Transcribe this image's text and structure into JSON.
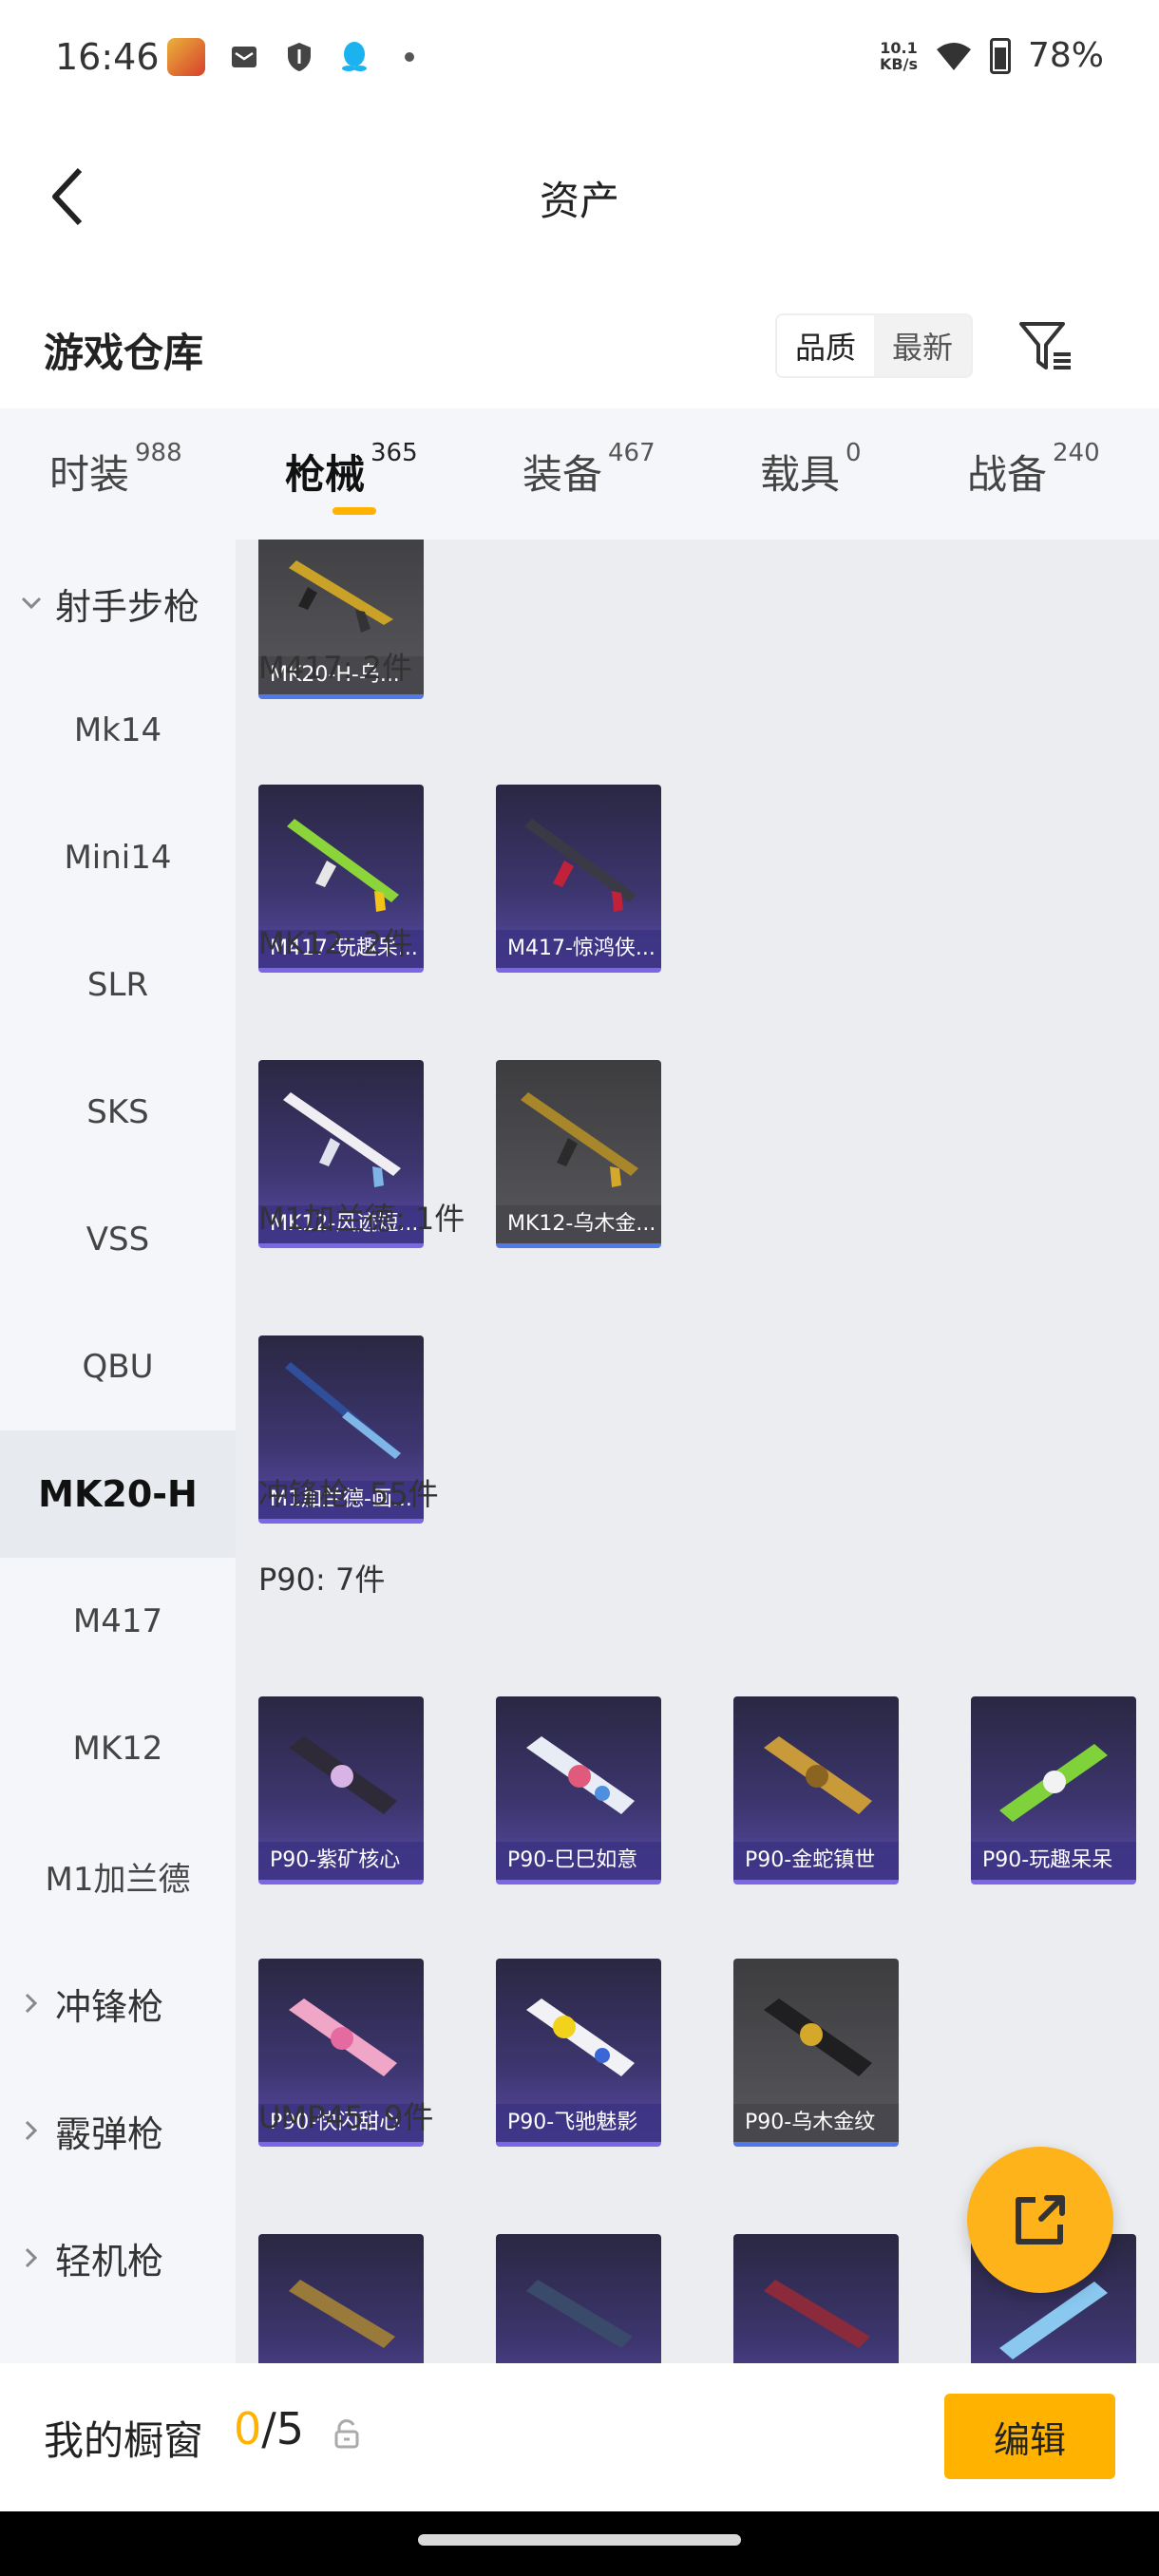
{
  "status_bar": {
    "time": "16:46",
    "speed": "10.1",
    "speed_unit": "KB/s",
    "battery": "78%"
  },
  "header": {
    "title": "资产"
  },
  "warehouse": {
    "title": "游戏仓库",
    "sort_quality": "品质",
    "sort_latest": "最新"
  },
  "tabs": [
    {
      "label": "时装",
      "count": "988"
    },
    {
      "label": "枪械",
      "count": "365"
    },
    {
      "label": "装备",
      "count": "467"
    },
    {
      "label": "载具",
      "count": "0"
    },
    {
      "label": "战备",
      "count": "240"
    }
  ],
  "sidebar": {
    "group_sniper": "射手步枪",
    "items": [
      "Mk14",
      "Mini14",
      "SLR",
      "SKS",
      "VSS",
      "QBU",
      "MK20-H",
      "M417",
      "MK12",
      "M1加兰德"
    ],
    "active": "MK20-H",
    "group_smg": "冲锋枪",
    "group_shotgun": "霰弹枪",
    "group_lmg": "轻机枪"
  },
  "content": {
    "top_card": "MK20-H-乌...",
    "m417_label": "M417: 2件",
    "m417_cards": [
      "M417-玩趣呆...",
      "M417-惊鸿侠..."
    ],
    "mk12_label": "MK12: 2件",
    "mk12_cards": [
      "MK12-风迹短...",
      "MK12-乌木金..."
    ],
    "m1_label": "M1加兰德: 1件",
    "m1_cards": [
      "M1加兰德-画..."
    ],
    "smg_label": "冲锋枪: 55件",
    "p90_label": "P90: 7件",
    "p90_cards": [
      "P90-紫矿核心",
      "P90-巳巳如意",
      "P90-金蛇镇世",
      "P90-玩趣呆呆",
      "P90-快闪甜心",
      "P90-飞驰魅影",
      "P90-乌木金纹"
    ],
    "ump_label": "UMP45: 9件"
  },
  "bottom_bar": {
    "title": "我的橱窗",
    "current": "0",
    "total": "/5",
    "edit_label": "编辑"
  },
  "colors": {
    "accent": "#ffb300",
    "epic": "#7b66e6",
    "rare": "#4f78e8"
  }
}
